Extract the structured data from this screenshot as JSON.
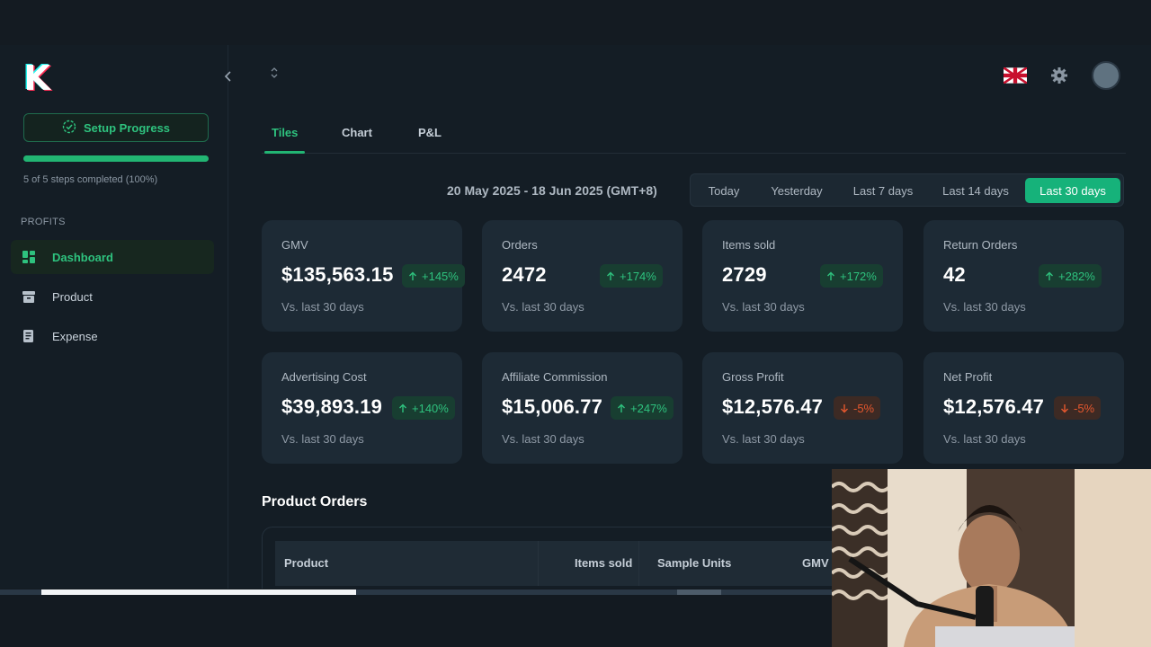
{
  "brand": {
    "logo_letter": "K"
  },
  "sidebar": {
    "setup_label": "Setup Progress",
    "progress_percent": 100,
    "steps_text": "5 of 5 steps completed (100%)",
    "section_label": "PROFITS",
    "items": [
      {
        "label": "Dashboard",
        "icon": "dashboard-icon",
        "active": true
      },
      {
        "label": "Product",
        "icon": "archive-icon",
        "active": false
      },
      {
        "label": "Expense",
        "icon": "receipt-icon",
        "active": false
      }
    ]
  },
  "tabs": [
    {
      "label": "Tiles",
      "active": true
    },
    {
      "label": "Chart",
      "active": false
    },
    {
      "label": "P&L",
      "active": false
    }
  ],
  "date_range": "20 May 2025 - 18 Jun 2025 (GMT+8)",
  "ranges": [
    {
      "label": "Today",
      "active": false
    },
    {
      "label": "Yesterday",
      "active": false
    },
    {
      "label": "Last 7 days",
      "active": false
    },
    {
      "label": "Last 14 days",
      "active": false
    },
    {
      "label": "Last 30 days",
      "active": true
    }
  ],
  "cards": [
    {
      "label": "GMV",
      "value": "$135,563.15",
      "change": "+145%",
      "direction": "up",
      "sub": "Vs. last 30 days"
    },
    {
      "label": "Orders",
      "value": "2472",
      "change": "+174%",
      "direction": "up",
      "sub": "Vs. last 30 days"
    },
    {
      "label": "Items sold",
      "value": "2729",
      "change": "+172%",
      "direction": "up",
      "sub": "Vs. last 30 days"
    },
    {
      "label": "Return Orders",
      "value": "42",
      "change": "+282%",
      "direction": "up",
      "sub": "Vs. last 30 days"
    },
    {
      "label": "Advertising Cost",
      "value": "$39,893.19",
      "change": "+140%",
      "direction": "up",
      "sub": "Vs. last 30 days"
    },
    {
      "label": "Affiliate Commission",
      "value": "$15,006.77",
      "change": "+247%",
      "direction": "up",
      "sub": "Vs. last 30 days"
    },
    {
      "label": "Gross Profit",
      "value": "$12,576.47",
      "change": "-5%",
      "direction": "down",
      "sub": "Vs. last 30 days"
    },
    {
      "label": "Net Profit",
      "value": "$12,576.47",
      "change": "-5%",
      "direction": "down",
      "sub": "Vs. last 30 days"
    }
  ],
  "product_orders": {
    "title": "Product Orders",
    "columns": [
      "Product",
      "Items sold",
      "Sample Units",
      "GMV"
    ]
  },
  "colors": {
    "accent": "#22b573",
    "positive": "#2ec27e",
    "negative": "#e4572e",
    "card_bg": "#1d2a35",
    "page_bg": "#141d25"
  }
}
